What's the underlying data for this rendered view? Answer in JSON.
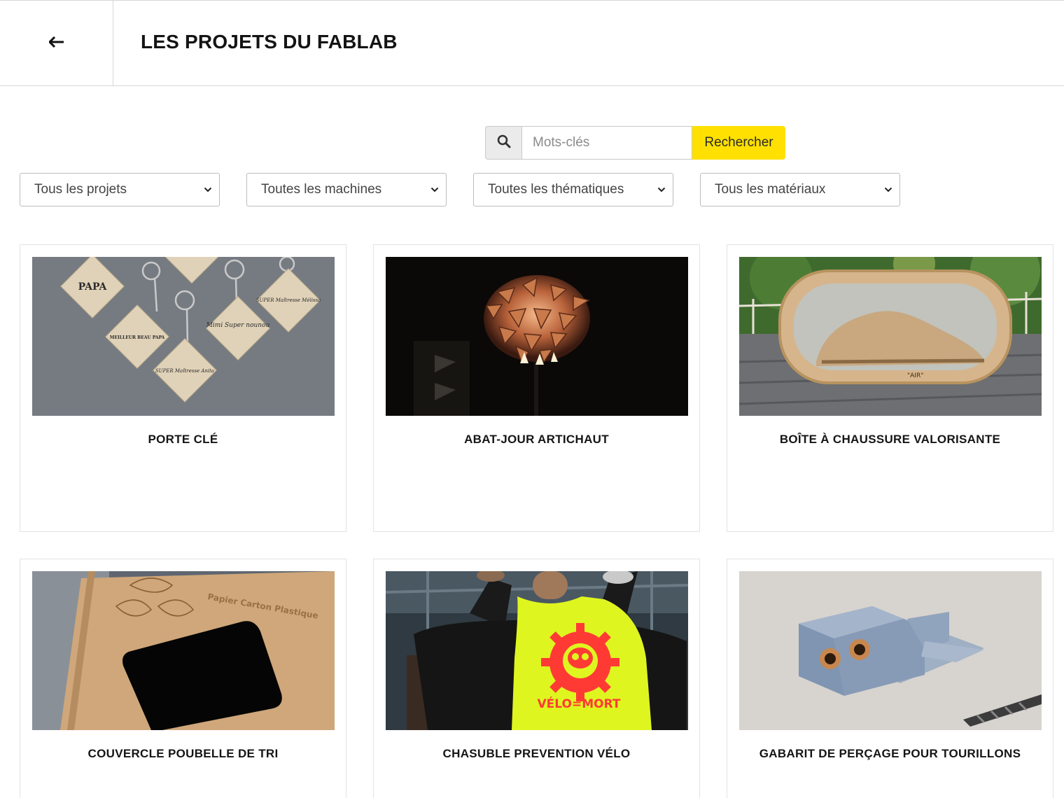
{
  "header": {
    "title": "LES PROJETS DU FABLAB"
  },
  "search": {
    "placeholder": "Mots-clés",
    "button_label": "Rechercher"
  },
  "filters": [
    {
      "selected": "Tous les projets"
    },
    {
      "selected": "Toutes les machines"
    },
    {
      "selected": "Toutes les thématiques"
    },
    {
      "selected": "Tous les matériaux"
    }
  ],
  "projects": [
    {
      "title": "PORTE CLÉ",
      "keychain_texts": [
        "PAPA",
        "Mimi Super nounou",
        "SUPER Maîtresse Mélissa",
        "SUPER Maîtresse Anita",
        "MEILLEUR BEAU PAPA"
      ]
    },
    {
      "title": "ABAT-JOUR ARTICHAUT"
    },
    {
      "title": "BOÎTE À CHAUSSURE VALORISANTE",
      "box_text": "\"AIR\""
    },
    {
      "title": "COUVERCLE POUBELLE DE TRI",
      "engraving_text": "Papier Carton Plastique"
    },
    {
      "title": "CHASUBLE PREVENTION VÉLO",
      "vest_text": "VÉLO=MORT"
    },
    {
      "title": "GABARIT DE PERÇAGE POUR TOURILLONS"
    }
  ],
  "colors": {
    "accent": "#ffe000",
    "border": "#d6d6d6"
  }
}
